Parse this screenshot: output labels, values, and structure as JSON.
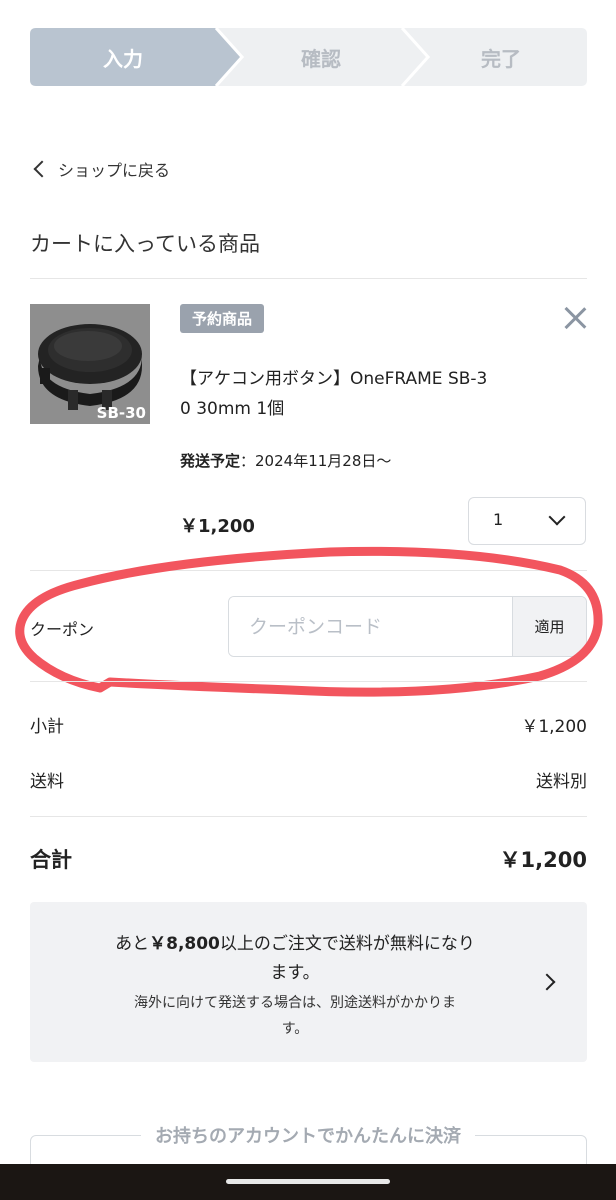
{
  "steps": [
    "入力",
    "確認",
    "完了"
  ],
  "back_link": "ショップに戻る",
  "cart_title": "カートに入っている商品",
  "item": {
    "thumb_label": "SB-30",
    "badge": "予約商品",
    "name_line1": "【アケコン用ボタン】OneFRAME SB-3",
    "name_line2": "0 30mm 1個",
    "ship_label": "発送予定",
    "ship_value": "：2024年11月28日〜",
    "price": "￥1,200",
    "quantity": "1"
  },
  "coupon": {
    "label": "クーポン",
    "placeholder": "クーポンコード",
    "apply": "適用"
  },
  "summary": {
    "subtotal_label": "小計",
    "subtotal_value": "￥1,200",
    "shipping_label": "送料",
    "shipping_value": "送料別",
    "total_label": "合計",
    "total_value": "￥1,200"
  },
  "notice": {
    "prefix": "あと",
    "amount": "￥8,800",
    "line1_rest": "以上のご注文で送料が無料になり",
    "line2": "ます。",
    "sub_line1": "海外に向けて発送する場合は、別途送料がかかりま",
    "sub_line2": "す。"
  },
  "account_title": "お持ちのアカウントでかんたんに決済",
  "annotation_color": "#f2555e"
}
